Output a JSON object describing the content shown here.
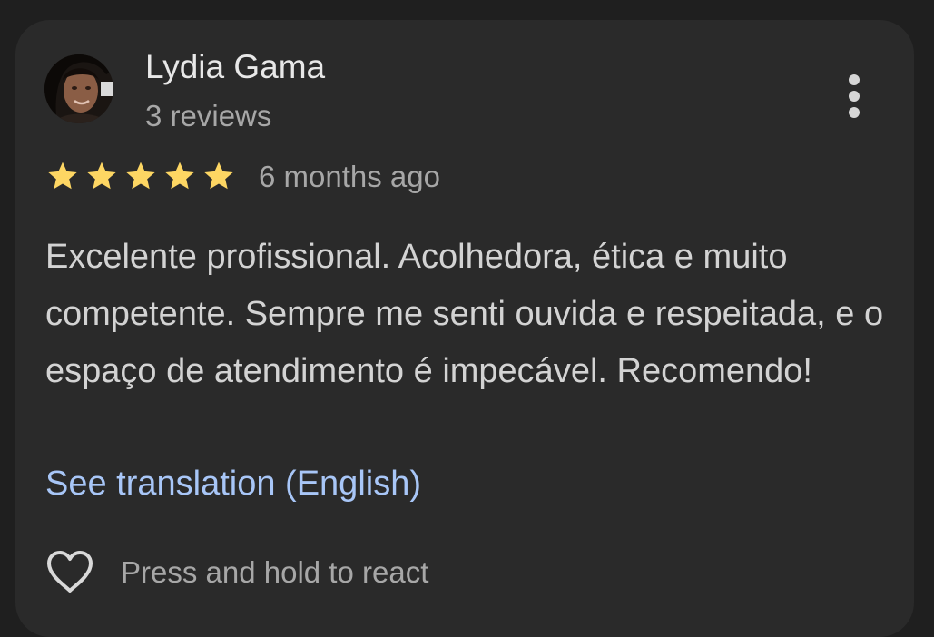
{
  "review": {
    "author_name": "Lydia Gama",
    "author_meta": "3 reviews",
    "rating": 5,
    "rating_max": 5,
    "star_color": "#fdd663",
    "time_ago": "6 months ago",
    "text": "Excelente profissional. Acolhedora, ética e muito competente. Sempre me senti ouvida e respeitada, e o espaço de atendimento é impecável. Recomendo!",
    "translate_label": "See translation (English)",
    "react_label": "Press and hold to react",
    "icons": {
      "avatar": "profile-photo",
      "more": "more-vert-icon",
      "rating": "star-icon",
      "react": "heart-outline-icon"
    }
  },
  "colors": {
    "background": "#1f1f1f",
    "card": "#2a2a2a",
    "link": "#a8c6f7",
    "primary_text": "#e8e8e8",
    "secondary_text": "#a7a7a7"
  }
}
